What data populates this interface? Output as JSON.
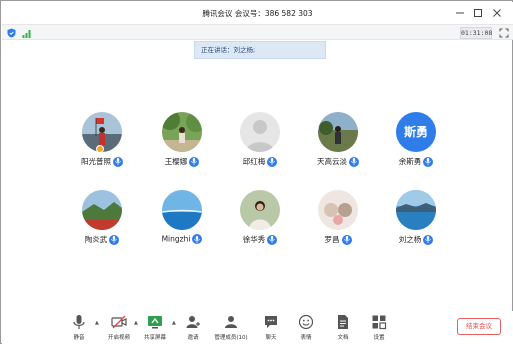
{
  "window": {
    "title": "腾讯会议  会议号：386 582 303",
    "min_icon": "minimize-icon",
    "max_icon": "maximize-icon",
    "close_icon": "close-icon"
  },
  "status": {
    "timer": "01:31:08"
  },
  "speaking_banner": "正在讲话：刘之杨;",
  "participants": [
    {
      "name": "阳光普照",
      "avatar": "photo-red-flag",
      "host": true
    },
    {
      "name": "王樱娜",
      "avatar": "photo-trees",
      "host": false
    },
    {
      "name": "邱红梅",
      "avatar": "default-gray",
      "host": false
    },
    {
      "name": "天高云淡",
      "avatar": "photo-outdoor",
      "host": false
    },
    {
      "name": "余斯勇",
      "avatar_text": "斯勇",
      "host": false
    },
    {
      "name": "陶炎武",
      "avatar": "photo-landscape-red",
      "host": false
    },
    {
      "name": "Mingzhi",
      "avatar": "photo-sea",
      "host": false
    },
    {
      "name": "徐华秀",
      "avatar": "photo-portrait",
      "host": false
    },
    {
      "name": "罗昌",
      "avatar": "photo-cats",
      "host": false
    },
    {
      "name": "刘之杨",
      "avatar": "photo-lake",
      "host": false
    }
  ],
  "toolbar": {
    "mute": "静音",
    "video": "开启视频",
    "share": "共享屏幕",
    "invite": "邀请",
    "members": "管理成员(10)",
    "chat": "聊天",
    "emoji": "表情",
    "docs": "文档",
    "settings": "设置",
    "end": "结束会议"
  },
  "colors": {
    "accent": "#2f7de9",
    "end": "#e04848",
    "banner_bg": "#dde8f7"
  }
}
